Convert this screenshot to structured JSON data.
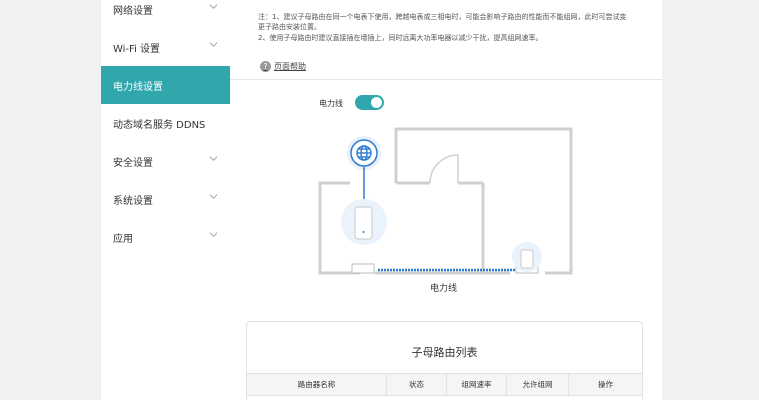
{
  "sidebar": {
    "items": [
      {
        "label": "网络设置",
        "expandable": true,
        "active": false
      },
      {
        "label": "Wi-Fi 设置",
        "expandable": true,
        "active": false
      },
      {
        "label": "电力线设置",
        "expandable": false,
        "active": true
      },
      {
        "label": "动态域名服务 DDNS",
        "expandable": false,
        "active": false
      },
      {
        "label": "安全设置",
        "expandable": true,
        "active": false
      },
      {
        "label": "系统设置",
        "expandable": true,
        "active": false
      },
      {
        "label": "应用",
        "expandable": true,
        "active": false
      }
    ]
  },
  "notes": {
    "line1": "注：1、建议子母路由在同一个电表下使用，跨越电表或三相电时，可能会影响子路由的性能而不能组网，此时可尝试变",
    "line2": "更子路由安装位置。",
    "line3": "2、使用子母路由时建议直接插在墙插上，同时远离大功率电器以减少干扰，提高组网速率。",
    "help_icon_glyph": "?",
    "help_label": "页面帮助"
  },
  "powerline": {
    "label": "电力线",
    "enabled": true,
    "diagram_caption": "电力线"
  },
  "router_table": {
    "title": "子母路由列表",
    "columns": [
      "路由器名称",
      "状态",
      "组网速率",
      "允许组网",
      "操作"
    ]
  },
  "colors": {
    "accent": "#2fa7ad",
    "link_blue": "#2b7bd3",
    "wall_gray": "#d0d0d0"
  }
}
